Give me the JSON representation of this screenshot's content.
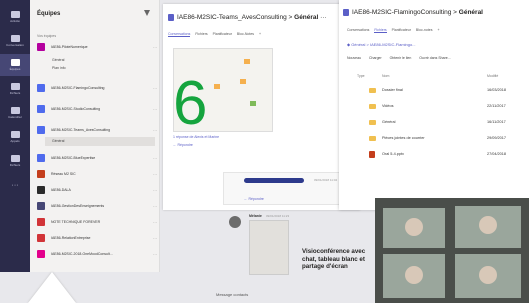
{
  "rail": {
    "items": [
      {
        "label": "Activité",
        "icon": "bell-icon"
      },
      {
        "label": "Conversation",
        "icon": "chat-icon"
      },
      {
        "label": "Équipes",
        "icon": "teams-icon"
      },
      {
        "label": "Fichiers",
        "icon": "files-icon"
      },
      {
        "label": "Calendrier",
        "icon": "calendar-icon"
      },
      {
        "label": "Appels",
        "icon": "phone-icon"
      },
      {
        "label": "Fichiers",
        "icon": "files-icon"
      },
      {
        "label": "",
        "icon": "more-icon"
      }
    ]
  },
  "teams_panel": {
    "header": "Équipes",
    "favorites_label": "Vos équipes",
    "teams": [
      {
        "name": "IAE86-PiloteNumerique",
        "color": "#b4009e"
      },
      {
        "name": "IAE86-M2SIC-FlamingoConsulting",
        "color": "#4f6bed"
      },
      {
        "name": "IAE86-M2SIC-StudioConsulting",
        "color": "#4f6bed"
      },
      {
        "name": "IAE86-M2SIC-Teams_AvesConsulting",
        "color": "#4f6bed"
      },
      {
        "name": "IAE86-M2SIC-BlueExpertise",
        "color": "#4f6bed"
      },
      {
        "name": "Réseau M2 SIC",
        "color": "#c43e1c"
      },
      {
        "name": "IAE86-DALA",
        "color": "#2b2b2b"
      },
      {
        "name": "IAE86-GestionDesEnseignements",
        "color": "#464775"
      },
      {
        "name": "NOTE TECHNIQUE FOREVER",
        "color": "#d13438"
      },
      {
        "name": "IAE86-RelationEntreprise",
        "color": "#d13438"
      },
      {
        "name": "IAE86-M2SIC-2018-OneMoodConsult...",
        "color": "#e3008c"
      }
    ],
    "channels_first": [
      "Général",
      "Plan info"
    ],
    "channel_selected": "Général"
  },
  "window1": {
    "title_prefix": "IAE86-M2SIC-Teams_AvesConsulting",
    "title_channel": "Général",
    "tabs": [
      "Conversations",
      "Fichiers",
      "Planificateur",
      "Bloc-Notes",
      "+"
    ],
    "caption": "1 réponse de Alexis et Marine",
    "reply_label": "← Répondre",
    "reply_label_2": "← Répondre",
    "timestamp_1": "09/01/2018 11:02",
    "timestamp_2": "09/01/2018 11:23",
    "author_2": "Mélanie"
  },
  "window2": {
    "title_prefix": "IAE86-M2SIC-FlamingoConsulting",
    "title_channel": "Général",
    "tabs": [
      "Conversations",
      "Fichiers",
      "Planificateur",
      "Bloc-notes",
      "+"
    ],
    "breadcrumb": "◆ Général > IAE86-M2SIC-Flamingo...",
    "toolbar": [
      "Nouveau",
      "Charger",
      "Obtenir le lien",
      "Ouvrir dans Share..."
    ],
    "columns": [
      "Type",
      "Nom",
      "Modifié"
    ],
    "files": [
      {
        "type": "folder",
        "name": "Dossier final",
        "modified": "16/03/2018"
      },
      {
        "type": "folder",
        "name": "Vidéos",
        "modified": "22/11/2017"
      },
      {
        "type": "folder",
        "name": "Général",
        "modified": "16/11/2017"
      },
      {
        "type": "folder",
        "name": "Pièces jointes de courrier",
        "modified": "29/09/2017"
      },
      {
        "type": "ppt",
        "name": "Oral 5-4.pptx",
        "modified": "27/04/2018"
      }
    ]
  },
  "overlay": {
    "number": "6",
    "number_color": "#15a43e",
    "visio_caption": "Visioconférence avec chat, tableau blanc et partage d'écran",
    "message_contacts": "Message contacts"
  },
  "colors": {
    "accent": "#5b5fc7",
    "rail_bg": "#2b2b4a",
    "panel_bg": "#f3f2f1"
  }
}
